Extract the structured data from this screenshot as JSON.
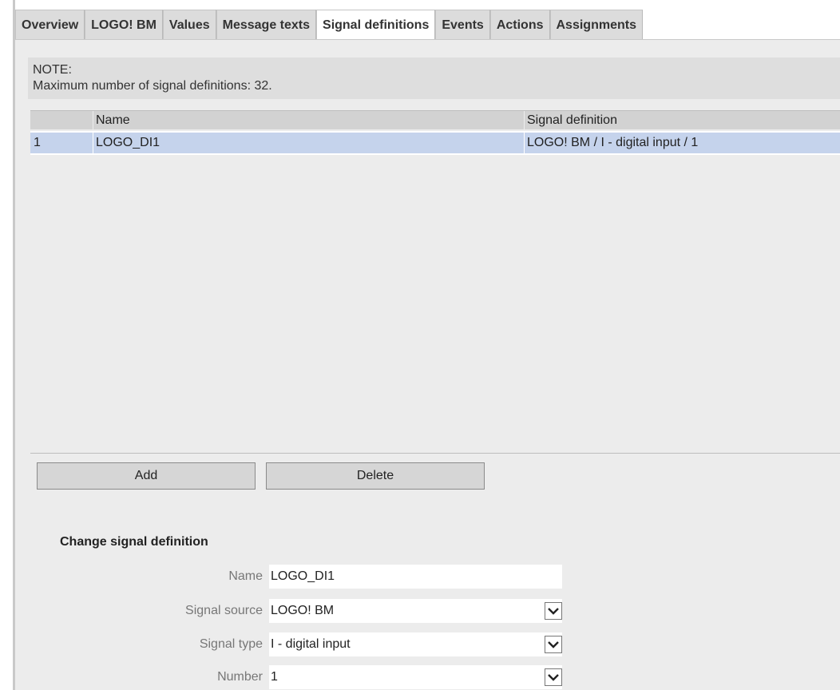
{
  "tabs": [
    {
      "label": "Overview"
    },
    {
      "label": "LOGO! BM"
    },
    {
      "label": "Values"
    },
    {
      "label": "Message texts"
    },
    {
      "label": "Signal definitions",
      "active": true
    },
    {
      "label": "Events"
    },
    {
      "label": "Actions"
    },
    {
      "label": "Assignments"
    }
  ],
  "note": {
    "title": "NOTE:",
    "text": "Maximum number of signal definitions: 32."
  },
  "table": {
    "headers": [
      "",
      "Name",
      "Signal definition"
    ],
    "rows": [
      {
        "num": "1",
        "name": "LOGO_DI1",
        "signal": "LOGO! BM / I - digital input / 1"
      }
    ]
  },
  "buttons": {
    "add": "Add",
    "delete": "Delete"
  },
  "form": {
    "title": "Change signal definition",
    "name_label": "Name",
    "name_value": "LOGO_DI1",
    "source_label": "Signal source",
    "source_value": "LOGO! BM",
    "type_label": "Signal type",
    "type_value": "I - digital input",
    "number_label": "Number",
    "number_value": "1"
  },
  "colors": {
    "selected_row": "#c5d3ec",
    "panel": "#ececec",
    "tab_bg": "#dcdcdc"
  }
}
